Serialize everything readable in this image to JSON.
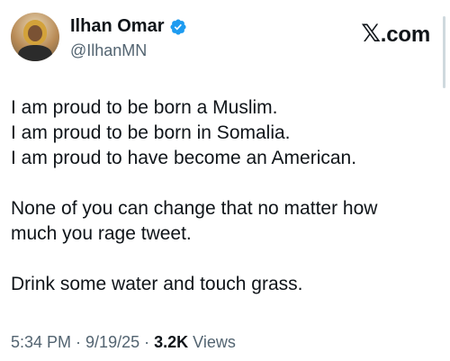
{
  "profile": {
    "display_name": "Ilhan Omar",
    "handle": "@IlhanMN",
    "verified": true,
    "avatar_icon": "profile-photo"
  },
  "brand": {
    "x_glyph": "𝕏",
    "suffix": ".com"
  },
  "tweet": {
    "lines_block1": [
      "I am proud to be born a Muslim.",
      "I am proud to be born in Somalia.",
      "I am proud to have become an American."
    ],
    "lines_block2": [
      "None of you can change that no matter how",
      "much you rage tweet."
    ],
    "lines_block3": [
      "Drink some water and touch grass."
    ]
  },
  "meta": {
    "time": "5:34 PM",
    "separator": " · ",
    "date": "9/19/25",
    "views_count": "3.2K",
    "views_label": " Views"
  },
  "colors": {
    "text_primary": "#0f1419",
    "text_secondary": "#536471",
    "verified_blue": "#1d9bf0"
  }
}
